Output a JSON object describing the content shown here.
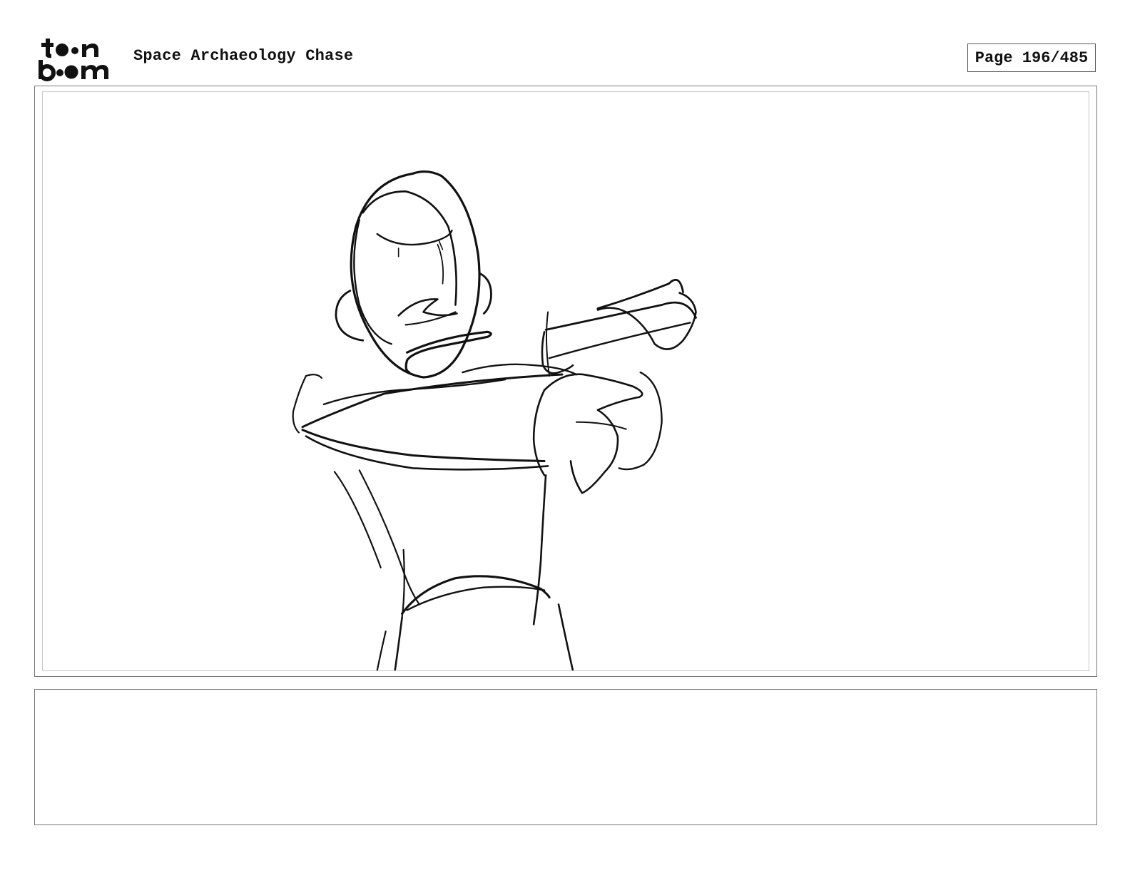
{
  "header": {
    "logo_top": "toon",
    "logo_bottom": "boom",
    "project_title": "Space Archaeology Chase",
    "page_label": "Page 196/485"
  },
  "panel": {
    "sketch_subject": "character-arms-crossed"
  },
  "notes": {
    "text": ""
  },
  "colors": {
    "ink": "#111111",
    "frame": "#777777",
    "inner_frame": "#c8c8c8"
  }
}
